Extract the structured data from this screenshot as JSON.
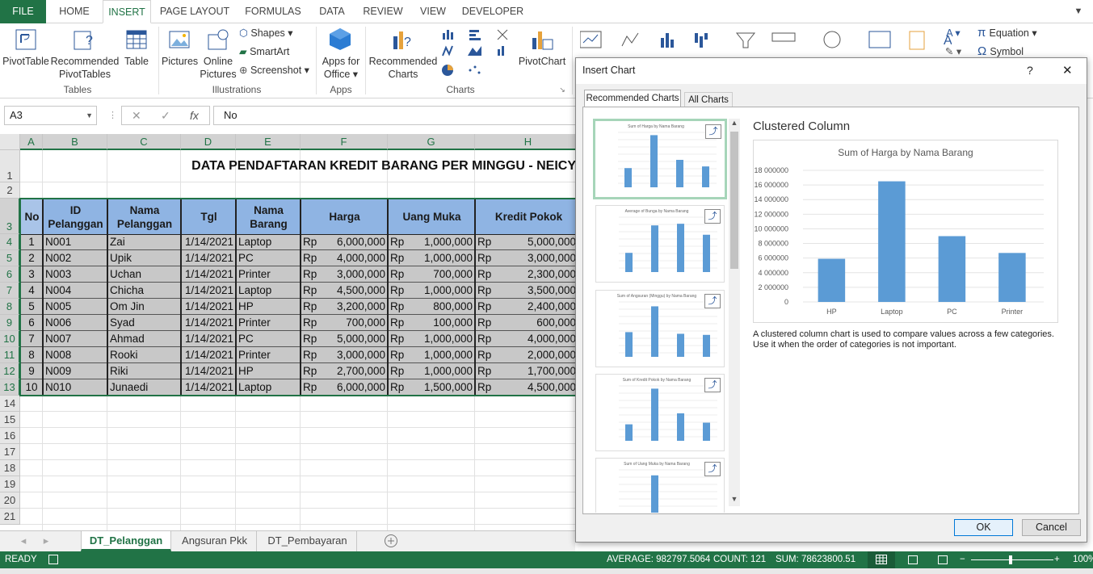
{
  "tabs": [
    "FILE",
    "HOME",
    "INSERT",
    "PAGE LAYOUT",
    "FORMULAS",
    "DATA",
    "REVIEW",
    "VIEW",
    "DEVELOPER"
  ],
  "ribbon": {
    "pivottable": "PivotTable",
    "rec_pivot_1": "Recommended",
    "rec_pivot_2": "PivotTables",
    "table": "Table",
    "group_tables": "Tables",
    "pictures": "Pictures",
    "online_1": "Online",
    "online_2": "Pictures",
    "shapes": "Shapes",
    "smartart": "SmartArt",
    "screenshot": "Screenshot",
    "group_illustrations": "Illustrations",
    "apps_1": "Apps for",
    "apps_2": "Office",
    "group_apps": "Apps",
    "rec_charts_1": "Recommended",
    "rec_charts_2": "Charts",
    "group_charts": "Charts",
    "pivotchart": "PivotChart",
    "equation": "Equation",
    "symbol": "Symbol"
  },
  "formula": {
    "namebox": "A3",
    "content": "No"
  },
  "grid": {
    "columns": [
      "A",
      "B",
      "C",
      "D",
      "E",
      "F",
      "G",
      "H"
    ],
    "title": "DATA PENDAFTARAN KREDIT BARANG PER MINGGU - NEICY",
    "headers": [
      "No",
      "ID Pelanggan",
      "Nama Pelanggan",
      "Tgl",
      "Nama Barang",
      "Harga",
      "Uang Muka",
      "Kredit Pokok"
    ],
    "rows": [
      [
        "1",
        "N001",
        "Zai",
        "1/14/2021",
        "Laptop",
        "Rp",
        "6,000,000",
        "Rp",
        "1,000,000",
        "Rp",
        "5,000,000"
      ],
      [
        "2",
        "N002",
        "Upik",
        "1/14/2021",
        "PC",
        "Rp",
        "4,000,000",
        "Rp",
        "1,000,000",
        "Rp",
        "3,000,000"
      ],
      [
        "3",
        "N003",
        "Uchan",
        "1/14/2021",
        "Printer",
        "Rp",
        "3,000,000",
        "Rp",
        "700,000",
        "Rp",
        "2,300,000"
      ],
      [
        "4",
        "N004",
        "Chicha",
        "1/14/2021",
        "Laptop",
        "Rp",
        "4,500,000",
        "Rp",
        "1,000,000",
        "Rp",
        "3,500,000"
      ],
      [
        "5",
        "N005",
        "Om Jin",
        "1/14/2021",
        "HP",
        "Rp",
        "3,200,000",
        "Rp",
        "800,000",
        "Rp",
        "2,400,000"
      ],
      [
        "6",
        "N006",
        "Syad",
        "1/14/2021",
        "Printer",
        "Rp",
        "700,000",
        "Rp",
        "100,000",
        "Rp",
        "600,000"
      ],
      [
        "7",
        "N007",
        "Ahmad",
        "1/14/2021",
        "PC",
        "Rp",
        "5,000,000",
        "Rp",
        "1,000,000",
        "Rp",
        "4,000,000"
      ],
      [
        "8",
        "N008",
        "Rooki",
        "1/14/2021",
        "Printer",
        "Rp",
        "3,000,000",
        "Rp",
        "1,000,000",
        "Rp",
        "2,000,000"
      ],
      [
        "9",
        "N009",
        "Riki",
        "1/14/2021",
        "HP",
        "Rp",
        "2,700,000",
        "Rp",
        "1,000,000",
        "Rp",
        "1,700,000"
      ],
      [
        "10",
        "N010",
        "Junaedi",
        "1/14/2021",
        "Laptop",
        "Rp",
        "6,000,000",
        "Rp",
        "1,500,000",
        "Rp",
        "4,500,000"
      ]
    ],
    "row_numbers": [
      "1",
      "2",
      "3",
      "4",
      "5",
      "6",
      "7",
      "8",
      "9",
      "10",
      "11",
      "12",
      "13",
      "14",
      "15",
      "16",
      "17",
      "18",
      "19",
      "20",
      "21"
    ]
  },
  "sheets": [
    "DT_Pelanggan",
    "Angsuran Pkk",
    "DT_Pembayaran"
  ],
  "status": {
    "ready": "READY",
    "average": "AVERAGE: 982797.5064",
    "count": "COUNT: 121",
    "sum": "SUM: 78623800.51",
    "zoom": "100%"
  },
  "dialog": {
    "title": "Insert Chart",
    "help": "?",
    "close": "✕",
    "tab_recommended": "Recommended Charts",
    "tab_all": "All Charts",
    "thumb_titles": [
      "Sum of Harga by Nama Barang",
      "Average of Bunga by Nama Barang",
      "Sum of Angsuran (Minggu) by Nama Barang",
      "Sum of Kredit Pokok by Nama Barang",
      "Sum of Uang Muka by Nama Barang"
    ],
    "preview_name": "Clustered Column",
    "description": "A clustered column chart is used to compare values across a few categories. Use it when the order of categories is not important.",
    "ok": "OK",
    "cancel": "Cancel"
  },
  "chart_data": {
    "type": "bar",
    "title": "Sum of Harga by Nama Barang",
    "categories": [
      "HP",
      "Laptop",
      "PC",
      "Printer"
    ],
    "values": [
      5900000,
      16500000,
      9000000,
      6700000
    ],
    "ylim": [
      0,
      18000000
    ],
    "yticks": [
      "0",
      "2000000",
      "4000000",
      "6000000",
      "8000000",
      "10000000",
      "12000000",
      "14000000",
      "16000000",
      "18000000"
    ],
    "color": "#5b9bd5",
    "grid": true,
    "xlabel": "",
    "ylabel": ""
  }
}
